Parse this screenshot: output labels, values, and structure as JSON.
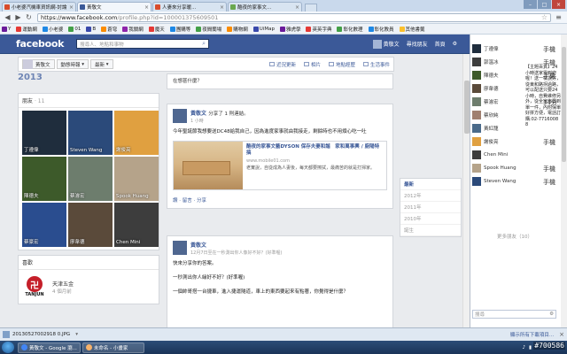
{
  "browser": {
    "tabs": [
      {
        "label": "小老婆汽機車資訊網-討論",
        "color": "#d94b2b"
      },
      {
        "label": "黃敬文",
        "color": "#3b5998"
      },
      {
        "label": "人妻來分享暖...",
        "color": "#d94b2b"
      },
      {
        "label": "酷夜的家事文...",
        "color": "#6aa84f"
      }
    ],
    "url_host": "https://www.facebook.com",
    "url_path": "/profile.php?id=100001375609501",
    "bookmarks": [
      {
        "label": "Y",
        "color": "#6a1b9a"
      },
      {
        "label": "運動網",
        "color": "#e53935"
      },
      {
        "label": "小老婆",
        "color": "#1e88e5"
      },
      {
        "label": "01",
        "color": "#43a047"
      },
      {
        "label": "B",
        "color": "#3949ab"
      },
      {
        "label": "蒼穹",
        "color": "#fb8c00"
      },
      {
        "label": "我關網",
        "color": "#8e24aa"
      },
      {
        "label": "魔天",
        "color": "#e53935"
      },
      {
        "label": "團購等",
        "color": "#1e88e5"
      },
      {
        "label": "夜間蘭場",
        "color": "#43a047"
      },
      {
        "label": "購物網",
        "color": "#fb8c00"
      },
      {
        "label": "UiMap",
        "color": "#3949ab"
      },
      {
        "label": "雅虎學",
        "color": "#6a1b9a"
      },
      {
        "label": "英英字典",
        "color": "#e53935"
      },
      {
        "label": "彰化數理",
        "color": "#43a047"
      },
      {
        "label": "彰化教員",
        "color": "#1e88e5"
      },
      {
        "label": "其他書籤",
        "color": "#fbc02d"
      }
    ]
  },
  "fb": {
    "logo": "facebook",
    "search_placeholder": "搜尋人、地點和事物",
    "nav": {
      "user": "黃敬文",
      "home": "首頁",
      "find_friends": "尋找朋友"
    },
    "profile_bar": {
      "name": "黃敬文",
      "activity": "動態時報",
      "latest": "最新"
    },
    "profile_tabs": [
      "近況更新",
      "相片",
      "地點經歷",
      "生活事件"
    ],
    "year_label": "2013",
    "top_fragment": "在想甚什麼？",
    "friends_box": {
      "title": "朋友",
      "count": "· 11"
    },
    "friends": [
      {
        "name": "丁遵偉",
        "bg": "#1f2d3d"
      },
      {
        "name": "Steven Wang",
        "bg": "#2b4a7a"
      },
      {
        "name": "謝俊亮",
        "bg": "#e0a040"
      },
      {
        "name": "陳德夫",
        "bg": "#3d5a2a"
      },
      {
        "name": "蔡濬宏",
        "bg": "#6d7d6d"
      },
      {
        "name": "Spook Huang",
        "bg": "#b5a38a"
      },
      {
        "name": "蔡豪宏",
        "bg": "#2a4d8f"
      },
      {
        "name": "廖韋德",
        "bg": "#5a4a3a"
      },
      {
        "name": "Chen Mini",
        "bg": "#3d3d3d"
      }
    ],
    "likes_box": {
      "title": "喜歡",
      "brand": "TANJUN",
      "name": "天津五金",
      "sub": "4 個月前"
    },
    "post1": {
      "author": "黃敬文",
      "action": "分享了 1 則連結。",
      "time": "1 小時",
      "body": "今年聖誕節我想要送DC48給我自己，因為進度家事就由我接走，剩餘時也不用煩心吃一吐",
      "link_title": "酷夜的家事文藝DYSON 保存夫妻和諧　家和萬事興 / 廚陽特搞",
      "link_site": "www.mobile01.com",
      "link_desc": "老實說，自從成為人妻後，每天都要擦拭，最痛苦的就是打掃家。",
      "actions": "讚 · 留言 · 分享"
    },
    "post2": {
      "author": "黃敬文",
      "time": "12月7日至在一秒測出你人像好不好？(好準喔)",
      "line1": "快來分享你的答案。",
      "line2": "一秒測出你人緣好不好？(好準喔)",
      "line3": "一個帥哥搭一台捷車，進入捷運隧道，車上的東西要起来有點著，你覺得是什麼？"
    },
    "year_nav": [
      "最新",
      "2012年",
      "2011年",
      "2010年",
      "誕生"
    ]
  },
  "chat": {
    "ticker": "【主題百貨】24小時送家電到府喔！送一樣說好，從東和路拐過路，可以配送只要24小時，自費維修另外，從全家佈置到單一件，內附保單好拼方便，電話訂購:02-77160088",
    "friends": [
      {
        "name": "丁遵偉",
        "status": "手機",
        "color": "#1f2d3d"
      },
      {
        "name": "郭溫冰",
        "status": "手機",
        "color": "#3d3d3d"
      },
      {
        "name": "陳德夫",
        "status": "手機",
        "color": "#3d5a2a"
      },
      {
        "name": "廖韋德",
        "status": "",
        "color": "#5a4a3a"
      },
      {
        "name": "蔡濬宏",
        "status": "34分",
        "color": "#6d7d6d"
      },
      {
        "name": "蔡欣純",
        "status": "",
        "color": "#a08070"
      },
      {
        "name": "黃紅龍",
        "status": "",
        "color": "#4a6a8a"
      },
      {
        "name": "謝俊亮",
        "status": "手機",
        "color": "#e0a040"
      },
      {
        "name": "Chen Mini",
        "status": "",
        "color": "#3d3d3d"
      },
      {
        "name": "Spook Huang",
        "status": "手機",
        "color": "#b5a38a"
      },
      {
        "name": "Steven Wang",
        "status": "手機",
        "color": "#2b4a7a"
      }
    ],
    "more_online": "更多朋友（10）",
    "search": "搜尋"
  },
  "downloads": {
    "file": "20130527002918 0.JPG",
    "show_all": "顯示所有下載項目..."
  },
  "taskbar": {
    "tasks": [
      {
        "label": "黃敬文 - Google 瀏...",
        "color": "#4285f4"
      },
      {
        "label": "未命名 - 小畫家",
        "color": "#f6b26b"
      }
    ],
    "tray_time": "",
    "watermark": "#700586"
  }
}
